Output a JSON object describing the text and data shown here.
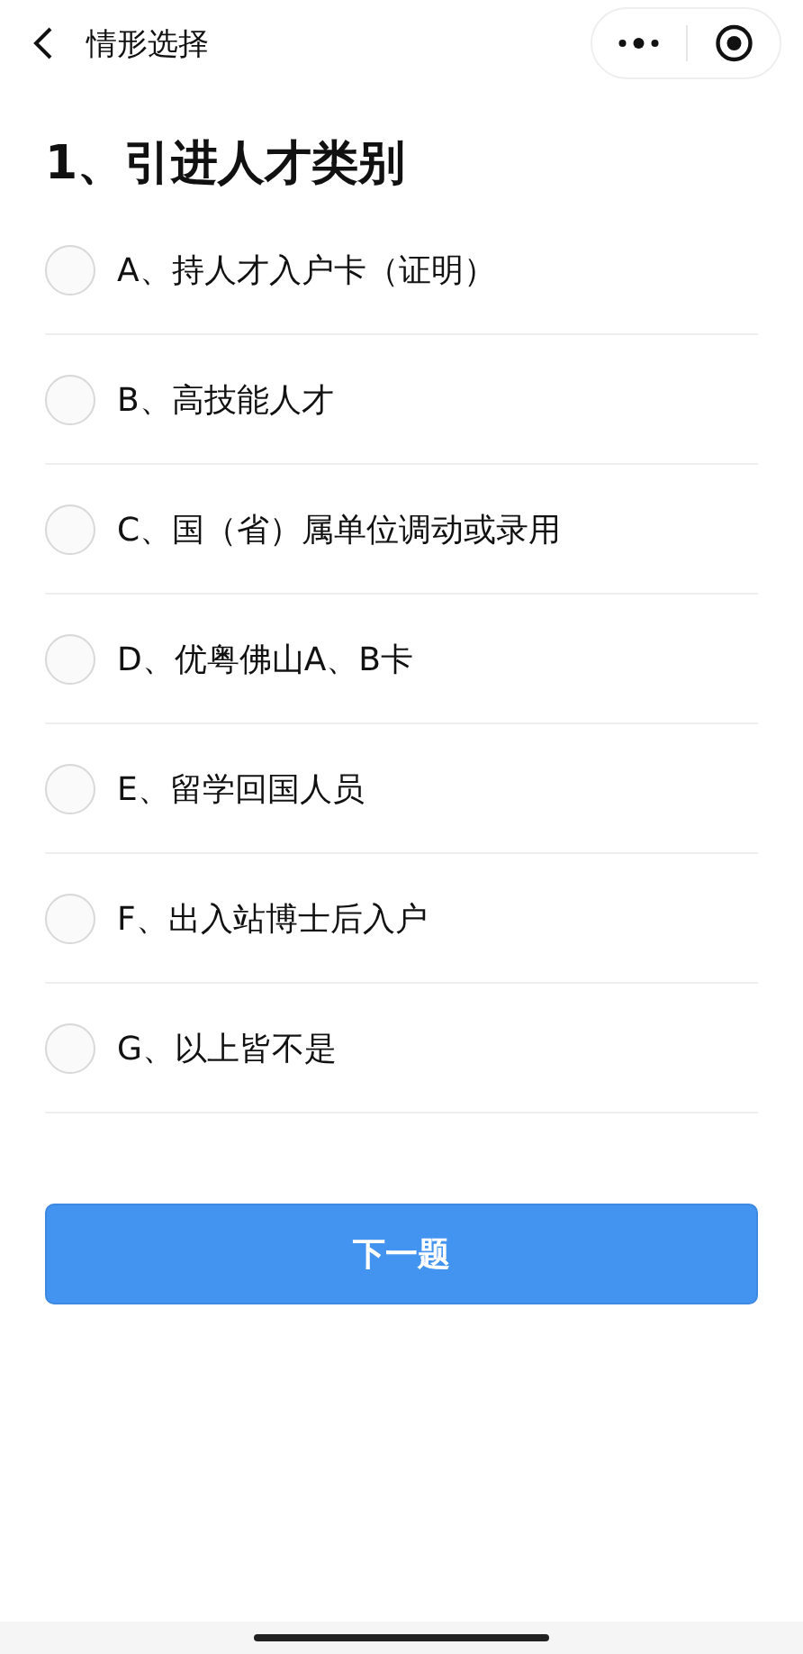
{
  "nav": {
    "title": "情形选择"
  },
  "question": {
    "title": "1、引进人才类别",
    "options": [
      {
        "label": "A、持人才入户卡（证明）",
        "selected": false
      },
      {
        "label": "B、高技能人才",
        "selected": false
      },
      {
        "label": "C、国（省）属单位调动或录用",
        "selected": false
      },
      {
        "label": "D、优粤佛山A、B卡",
        "selected": false
      },
      {
        "label": "E、留学回国人员",
        "selected": false
      },
      {
        "label": "F、出入站博士后入户",
        "selected": false
      },
      {
        "label": "G、以上皆不是",
        "selected": false
      }
    ]
  },
  "button": {
    "label": "下一题"
  }
}
